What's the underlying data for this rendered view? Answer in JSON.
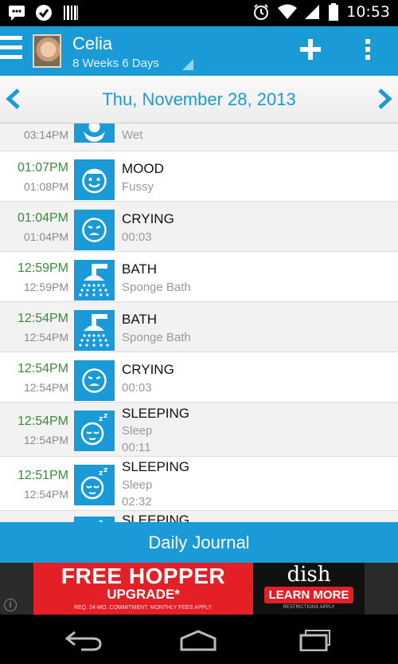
{
  "status_bar": {
    "time": "10:53",
    "icons_left": [
      "chat-icon",
      "check-icon",
      "barcode-icon"
    ],
    "icons_right": [
      "alarm-icon",
      "wifi-icon",
      "signal-icon",
      "battery-icon"
    ]
  },
  "header": {
    "profile_name": "Celia",
    "profile_age": "8 Weeks 6 Days"
  },
  "date_nav": {
    "date": "Thu, November 28, 2013"
  },
  "events": [
    {
      "start": "",
      "end": "03:14PM",
      "title": "",
      "sub": "Wet",
      "sub2": "",
      "icon": "diaper-icon"
    },
    {
      "start": "01:07PM",
      "end": "01:08PM",
      "title": "MOOD",
      "sub": "Fussy",
      "sub2": "",
      "icon": "mood-icon"
    },
    {
      "start": "01:04PM",
      "end": "01:04PM",
      "title": "CRYING",
      "sub": "00:03",
      "sub2": "",
      "icon": "crying-icon"
    },
    {
      "start": "12:59PM",
      "end": "12:59PM",
      "title": "BATH",
      "sub": "Sponge Bath",
      "sub2": "",
      "icon": "shower-icon"
    },
    {
      "start": "12:54PM",
      "end": "12:54PM",
      "title": "BATH",
      "sub": "Sponge Bath",
      "sub2": "",
      "icon": "shower-icon"
    },
    {
      "start": "12:54PM",
      "end": "12:54PM",
      "title": "CRYING",
      "sub": "00:03",
      "sub2": "",
      "icon": "crying-icon"
    },
    {
      "start": "12:54PM",
      "end": "12:54PM",
      "title": "SLEEPING",
      "sub": "Sleep",
      "sub2": "00:11",
      "icon": "sleeping-icon"
    },
    {
      "start": "12:51PM",
      "end": "12:54PM",
      "title": "SLEEPING",
      "sub": "Sleep",
      "sub2": "02:32",
      "icon": "sleeping-icon"
    },
    {
      "start": "",
      "end": "",
      "title": "SLEEPING",
      "sub": "",
      "sub2": "",
      "icon": "sleeping-icon"
    }
  ],
  "footer": {
    "journal_label": "Daily Journal"
  },
  "ad": {
    "headline": "FREE HOPPER",
    "subhead": "UPGRADE*",
    "fine_print": "REQ. 24-MO. COMMITMENT. MONTHLY FEES APPLY.",
    "brand": "dish",
    "cta": "LEARN MORE",
    "restrictions": "RESTRICTIONS APPLY",
    "info": "i"
  },
  "colors": {
    "accent": "#1a9bd7",
    "start_time": "#3f8a3f",
    "ad_red": "#e41f26"
  }
}
